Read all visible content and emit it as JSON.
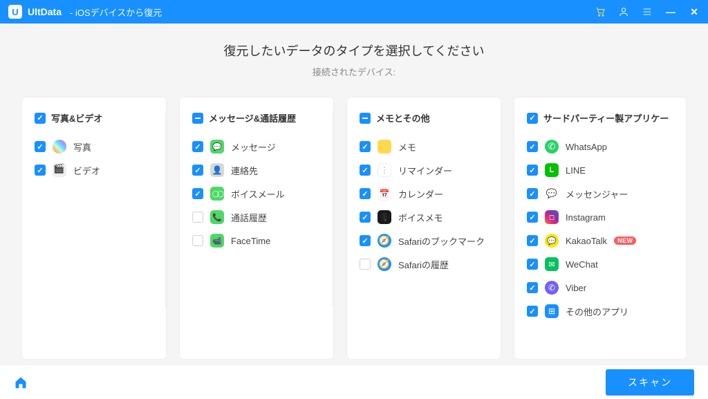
{
  "titlebar": {
    "logo_letter": "U",
    "app_name": "UltData",
    "subtitle": "- iOSデバイスから復元"
  },
  "page": {
    "title": "復元したいデータのタイプを選択してください",
    "device_label": "接続されたデバイス:"
  },
  "columns": [
    {
      "header": "写真&ビデオ",
      "header_state": "checked",
      "items": [
        {
          "label": "写真",
          "state": "checked",
          "icon": "photos"
        },
        {
          "label": "ビデオ",
          "state": "checked",
          "icon": "video"
        }
      ]
    },
    {
      "header": "メッセージ&通話履歴",
      "header_state": "indeterminate",
      "items": [
        {
          "label": "メッセージ",
          "state": "checked",
          "icon": "msg"
        },
        {
          "label": "連絡先",
          "state": "checked",
          "icon": "contact"
        },
        {
          "label": "ボイスメール",
          "state": "checked",
          "icon": "voicemail"
        },
        {
          "label": "通話履歴",
          "state": "empty",
          "icon": "call"
        },
        {
          "label": "FaceTime",
          "state": "empty",
          "icon": "ft"
        }
      ]
    },
    {
      "header": "メモとその他",
      "header_state": "indeterminate",
      "items": [
        {
          "label": "メモ",
          "state": "checked",
          "icon": "notes"
        },
        {
          "label": "リマインダー",
          "state": "checked",
          "icon": "reminder"
        },
        {
          "label": "カレンダー",
          "state": "checked",
          "icon": "cal"
        },
        {
          "label": "ボイスメモ",
          "state": "checked",
          "icon": "voicememo"
        },
        {
          "label": "Safariのブックマーク",
          "state": "checked",
          "icon": "safari"
        },
        {
          "label": "Safariの履歴",
          "state": "empty",
          "icon": "safari"
        }
      ]
    },
    {
      "header": "サードパーティー製アプリケー",
      "header_state": "checked",
      "items": [
        {
          "label": "WhatsApp",
          "state": "checked",
          "icon": "whatsapp"
        },
        {
          "label": "LINE",
          "state": "checked",
          "icon": "line"
        },
        {
          "label": "メッセンジャー",
          "state": "checked",
          "icon": "messenger"
        },
        {
          "label": "Instagram",
          "state": "checked",
          "icon": "instagram"
        },
        {
          "label": "KakaoTalk",
          "state": "checked",
          "icon": "kakao",
          "badge": "NEW"
        },
        {
          "label": "WeChat",
          "state": "checked",
          "icon": "wechat"
        },
        {
          "label": "Viber",
          "state": "checked",
          "icon": "viber"
        },
        {
          "label": "その他のアプリ",
          "state": "checked",
          "icon": "other"
        }
      ]
    }
  ],
  "footer": {
    "scan_label": "スキャン"
  }
}
